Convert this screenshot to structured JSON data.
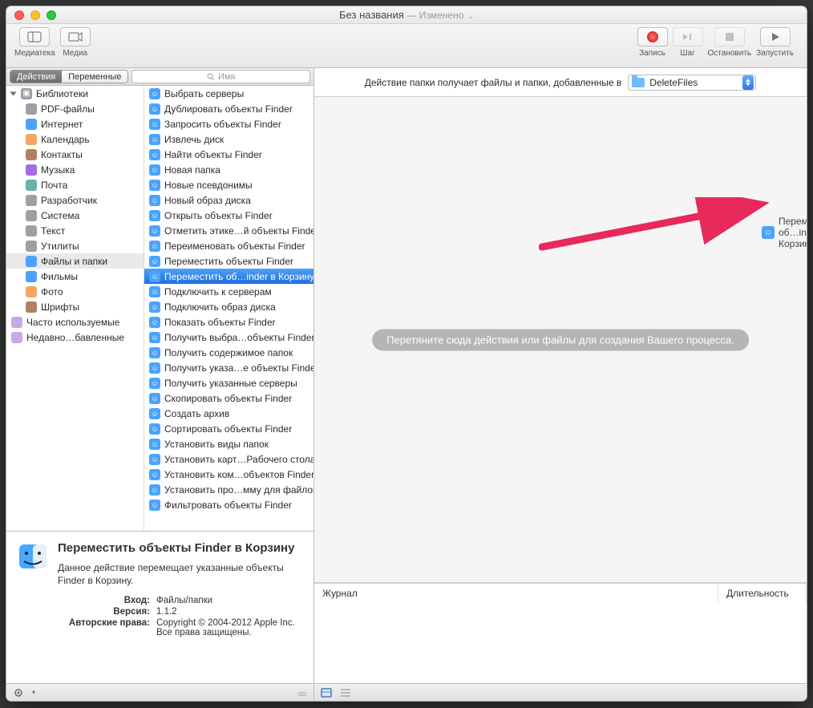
{
  "window": {
    "title": "Без названия",
    "subtitle": "— Изменено"
  },
  "toolbar": {
    "left": [
      {
        "label": "Медиатека",
        "name": "library-button"
      },
      {
        "label": "Медиа",
        "name": "media-button"
      }
    ],
    "right": [
      {
        "label": "Запись",
        "name": "record-button"
      },
      {
        "label": "Шаг",
        "name": "step-button"
      },
      {
        "label": "Остановить",
        "name": "stop-button"
      },
      {
        "label": "Запустить",
        "name": "run-button"
      }
    ]
  },
  "tabs": {
    "actions": "Действия",
    "variables": "Переменные",
    "search_placeholder": "Имя"
  },
  "library": {
    "root": "Библиотеки",
    "items": [
      {
        "label": "PDF-файлы",
        "name": "lib-pdf",
        "color": "grey"
      },
      {
        "label": "Интернет",
        "name": "lib-internet",
        "color": "blue"
      },
      {
        "label": "Календарь",
        "name": "lib-calendar",
        "color": "orange"
      },
      {
        "label": "Контакты",
        "name": "lib-contacts",
        "color": "brown"
      },
      {
        "label": "Музыка",
        "name": "lib-music",
        "color": "purple"
      },
      {
        "label": "Почта",
        "name": "lib-mail",
        "color": "teal"
      },
      {
        "label": "Разработчик",
        "name": "lib-developer",
        "color": "grey"
      },
      {
        "label": "Система",
        "name": "lib-system",
        "color": "grey"
      },
      {
        "label": "Текст",
        "name": "lib-text",
        "color": "grey"
      },
      {
        "label": "Утилиты",
        "name": "lib-utilities",
        "color": "grey"
      },
      {
        "label": "Файлы и папки",
        "name": "lib-files-folders",
        "color": "blue"
      },
      {
        "label": "Фильмы",
        "name": "lib-movies",
        "color": "blue"
      },
      {
        "label": "Фото",
        "name": "lib-photos",
        "color": "orange"
      },
      {
        "label": "Шрифты",
        "name": "lib-fonts",
        "color": "brown"
      }
    ],
    "extras": [
      {
        "label": "Часто используемые",
        "name": "lib-most-used"
      },
      {
        "label": "Недавно…бавленные",
        "name": "lib-recently-added"
      }
    ]
  },
  "actions": [
    "Выбрать серверы",
    "Дублировать объекты Finder",
    "Запросить объекты Finder",
    "Извлечь диск",
    "Найти объекты Finder",
    "Новая папка",
    "Новые псевдонимы",
    "Новый образ диска",
    "Открыть объекты Finder",
    "Отметить этике…й объекты Finder",
    "Переименовать объекты Finder",
    "Переместить объекты Finder",
    "Переместить об…inder в Корзину",
    "Подключить к серверам",
    "Подключить образ диска",
    "Показать объекты Finder",
    "Получить выбра…объекты Finder",
    "Получить содержимое папок",
    "Получить указа…е объекты Finder",
    "Получить указанные серверы",
    "Скопировать объекты Finder",
    "Создать архив",
    "Сортировать объекты Finder",
    "Установить виды папок",
    "Установить карт…Рабочего стола",
    "Установить ком…объектов Finder",
    "Установить про…мму для файлов",
    "Фильтровать объекты Finder"
  ],
  "selected_action_index": 12,
  "info": {
    "title": "Переместить объекты Finder в Корзину",
    "desc": "Данное действие перемещает указанные объекты Finder в Корзину.",
    "rows": [
      {
        "k": "Вход:",
        "v": "Файлы/папки"
      },
      {
        "k": "Версия:",
        "v": "1.1.2"
      },
      {
        "k": "Авторские права:",
        "v": "Copyright © 2004-2012 Apple Inc. Все права защищены."
      }
    ]
  },
  "flow": {
    "header_text": "Действие папки получает файлы и папки, добавленные в",
    "folder_name": "DeleteFiles",
    "dragged_label": "Переместить об…inder в Корзину",
    "hint": "Перетяните сюда действия или файлы для создания Вашего процесса."
  },
  "log": {
    "col1": "Журнал",
    "col2": "Длительность"
  }
}
